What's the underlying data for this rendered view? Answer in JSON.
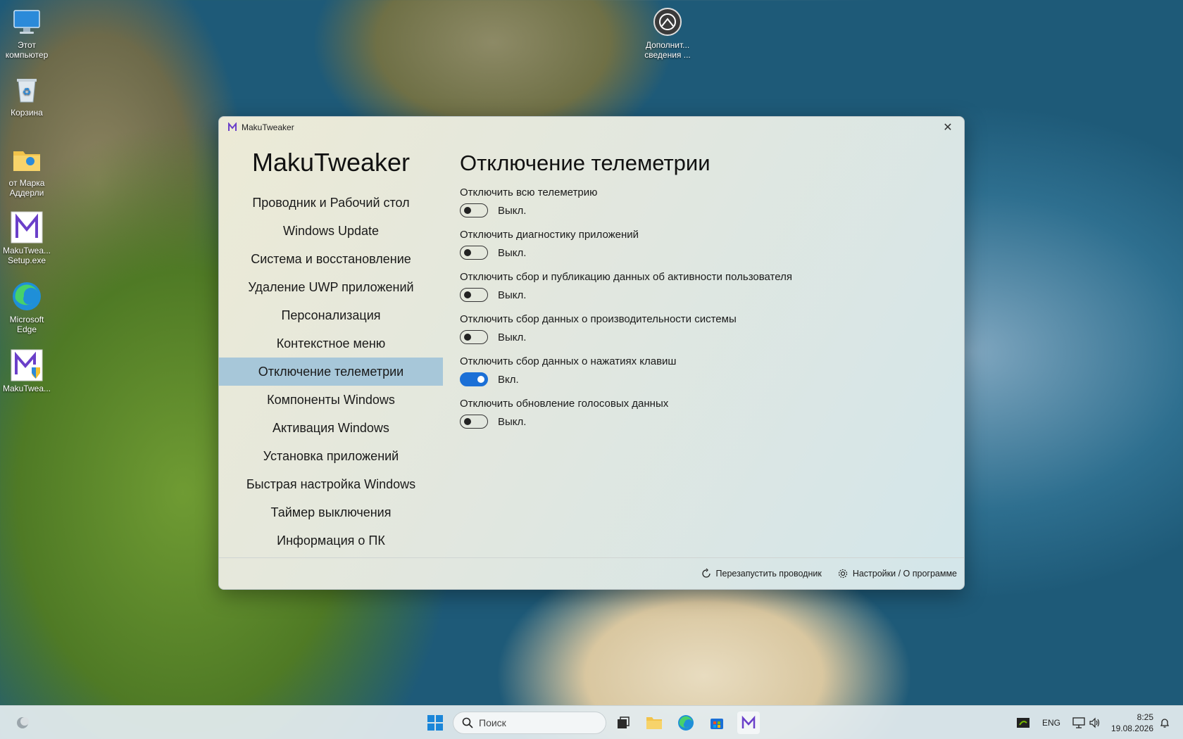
{
  "desktop": {
    "icons": [
      {
        "label": "Этот компьютер",
        "icon": "monitor-icon"
      },
      {
        "label": "Корзина",
        "icon": "recycle-bin-icon"
      },
      {
        "label": "от Марка Аддерли",
        "icon": "folder-icon"
      },
      {
        "label": "MakuTwea... Setup.exe",
        "icon": "makutweaker-icon"
      },
      {
        "label": "Microsoft Edge",
        "icon": "edge-icon"
      },
      {
        "label": "MakuTwea...",
        "icon": "makutweaker-shield-icon"
      },
      {
        "label": "Дополнит... сведения ...",
        "icon": "info-icon"
      }
    ]
  },
  "window": {
    "title": "MakuTweaker",
    "brand": "MakuTweaker",
    "nav": [
      "Проводник и Рабочий стол",
      "Windows Update",
      "Система и восстановление",
      "Удаление UWP приложений",
      "Персонализация",
      "Контекстное меню",
      "Отключение телеметрии",
      "Компоненты Windows",
      "Активация Windows",
      "Установка приложений",
      "Быстрая настройка Windows",
      "Таймер выключения",
      "Информация о ПК"
    ],
    "active_nav_index": 6,
    "page_title": "Отключение телеметрии",
    "settings": [
      {
        "label": "Отключить всю телеметрию",
        "state": "Выкл.",
        "on": false
      },
      {
        "label": "Отключить диагностику приложений",
        "state": "Выкл.",
        "on": false
      },
      {
        "label": "Отключить сбор и публикацию данных об активности пользователя",
        "state": "Выкл.",
        "on": false
      },
      {
        "label": "Отключить сбор данных о производительности системы",
        "state": "Выкл.",
        "on": false
      },
      {
        "label": "Отключить сбор данных о нажатиях клавиш",
        "state": "Вкл.",
        "on": true
      },
      {
        "label": "Отключить обновление голосовых данных",
        "state": "Выкл.",
        "on": false
      }
    ],
    "footer": {
      "restart_explorer": "Перезапустить проводник",
      "settings_about": "Настройки / О программе"
    }
  },
  "taskbar": {
    "search_placeholder": "Поиск",
    "language": "ENG",
    "time": "8:25",
    "date": "19.08.2026"
  },
  "colors": {
    "accent": "#1a6fd6",
    "active_nav": "#a7c7d9"
  }
}
